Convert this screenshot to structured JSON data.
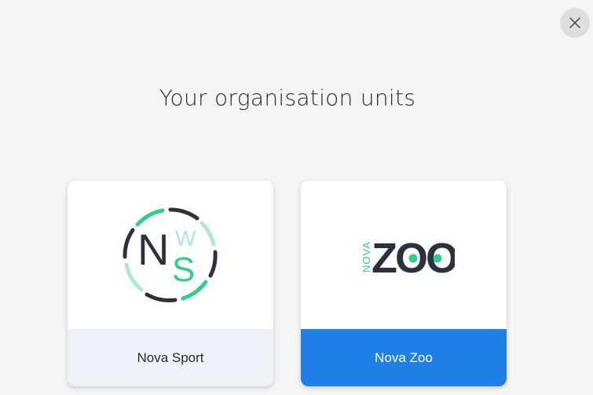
{
  "header": {
    "title": "Your organisation units",
    "close_icon": "close-icon"
  },
  "units": [
    {
      "name": "Nova Sport",
      "logo": {
        "letters": [
          "N",
          "W",
          "S"
        ]
      },
      "selected": false
    },
    {
      "name": "Nova Zoo",
      "logo": {
        "small_text": "NOVA",
        "main_text": "ZOO"
      },
      "selected": true
    }
  ],
  "colors": {
    "background": "#f5f5f5",
    "primary": "#1f80e8",
    "logo_dark": "#2c3140",
    "logo_green": "#2fcf8a",
    "logo_light_green": "#a9eccc",
    "footer_default": "#eef1f7"
  }
}
